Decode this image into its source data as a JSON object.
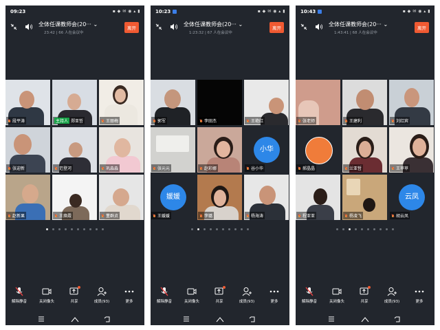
{
  "common": {
    "meeting_title": "全体任课教师会(20···",
    "leave_label": "离开",
    "toolbar": {
      "unmute": "解除静音",
      "camera_off": "关闭像头",
      "share": "共享",
      "members": "成员(93)",
      "more": "更多"
    },
    "accent_color": "#f05a32",
    "avatar_color": "#2d87e8",
    "host_tag_color": "#1aa34a",
    "icons": [
      "exit-fullscreen-icon",
      "speaker-icon",
      "chevron-down-icon",
      "mic-muted-icon",
      "camera-icon",
      "share-icon",
      "members-icon",
      "more-icon",
      "menu-icon",
      "home-icon",
      "back-icon"
    ]
  },
  "screens": [
    {
      "time": "09:23",
      "meeting_meta": "23:42 | 66 人在会议中",
      "tiles": [
        {
          "name": "段平涛"
        },
        {
          "name": "郑亚哲",
          "host": "主持人"
        },
        {
          "name": "王丽梅"
        },
        {
          "name": "张迎新"
        },
        {
          "name": "范登河"
        },
        {
          "name": "巩淼淼"
        },
        {
          "name": "赵新果"
        },
        {
          "name": "王焕霞"
        },
        {
          "name": "董群贞"
        }
      ]
    },
    {
      "time": "10:23",
      "meeting_meta": "1:23:32 | 67 人在会议中",
      "tiles": [
        {
          "name": "郭军"
        },
        {
          "name": "李田杰"
        },
        {
          "name": "王艳红"
        },
        {
          "name": "张元元"
        },
        {
          "name": "赵彩娜"
        },
        {
          "name": "谷小华",
          "avatar": "小华"
        },
        {
          "name": "王媛媛",
          "avatar": "媛媛"
        },
        {
          "name": "李璐"
        },
        {
          "name": "杨海涛"
        }
      ]
    },
    {
      "time": "10:43",
      "meeting_meta": "1:43:41 | 68 人在会议中",
      "tiles": [
        {
          "name": "张老师"
        },
        {
          "name": "王建利"
        },
        {
          "name": "刘红宾"
        },
        {
          "name": "郝晶晶"
        },
        {
          "name": "兰亚哲"
        },
        {
          "name": "王苹苹"
        },
        {
          "name": "程亚亚"
        },
        {
          "name": "杨凌飞"
        },
        {
          "name": "胡云凤",
          "avatar": "云凤"
        }
      ]
    }
  ],
  "pagination": {
    "count": 10,
    "active_pages": [
      1,
      2,
      3
    ]
  }
}
